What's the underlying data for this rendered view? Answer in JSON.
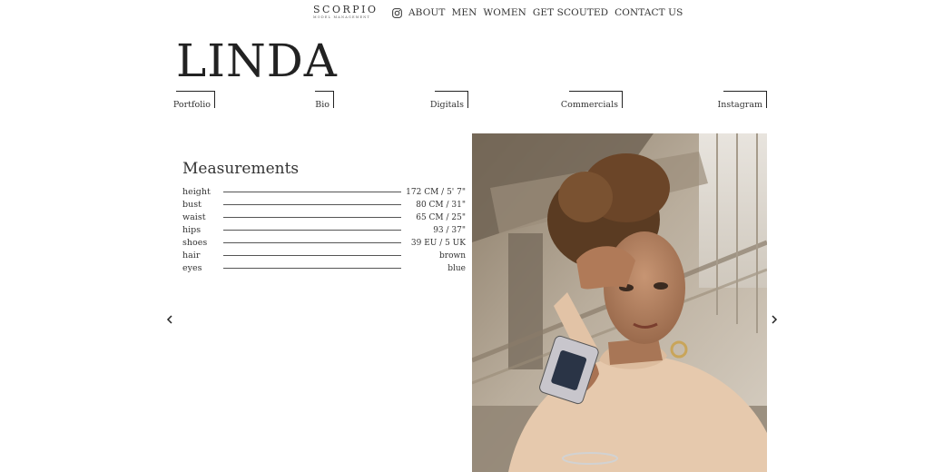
{
  "header": {
    "logo_main": "SCORPIO",
    "logo_sub": "MODEL MANAGEMENT",
    "instagram_icon": "instagram-icon",
    "nav": [
      "ABOUT",
      "MEN",
      "WOMEN",
      "GET SCOUTED",
      "CONTACT US"
    ]
  },
  "model": {
    "name": "LINDA"
  },
  "tabs": [
    "Portfolio",
    "Bio",
    "Digitals",
    "Commercials",
    "Instagram"
  ],
  "measurements": {
    "title": "Measurements",
    "rows": [
      {
        "label": "height",
        "value": "172 CM / 5' 7\""
      },
      {
        "label": "bust",
        "value": "80 CM / 31\""
      },
      {
        "label": "waist",
        "value": "65 CM / 25\""
      },
      {
        "label": "hips",
        "value": "93 / 37\""
      },
      {
        "label": "shoes",
        "value": "39 EU / 5 UK"
      },
      {
        "label": "hair",
        "value": "brown"
      },
      {
        "label": "eyes",
        "value": "blue"
      }
    ]
  },
  "carousel": {
    "prev_icon": "chevron-left-icon",
    "next_icon": "chevron-right-icon"
  }
}
